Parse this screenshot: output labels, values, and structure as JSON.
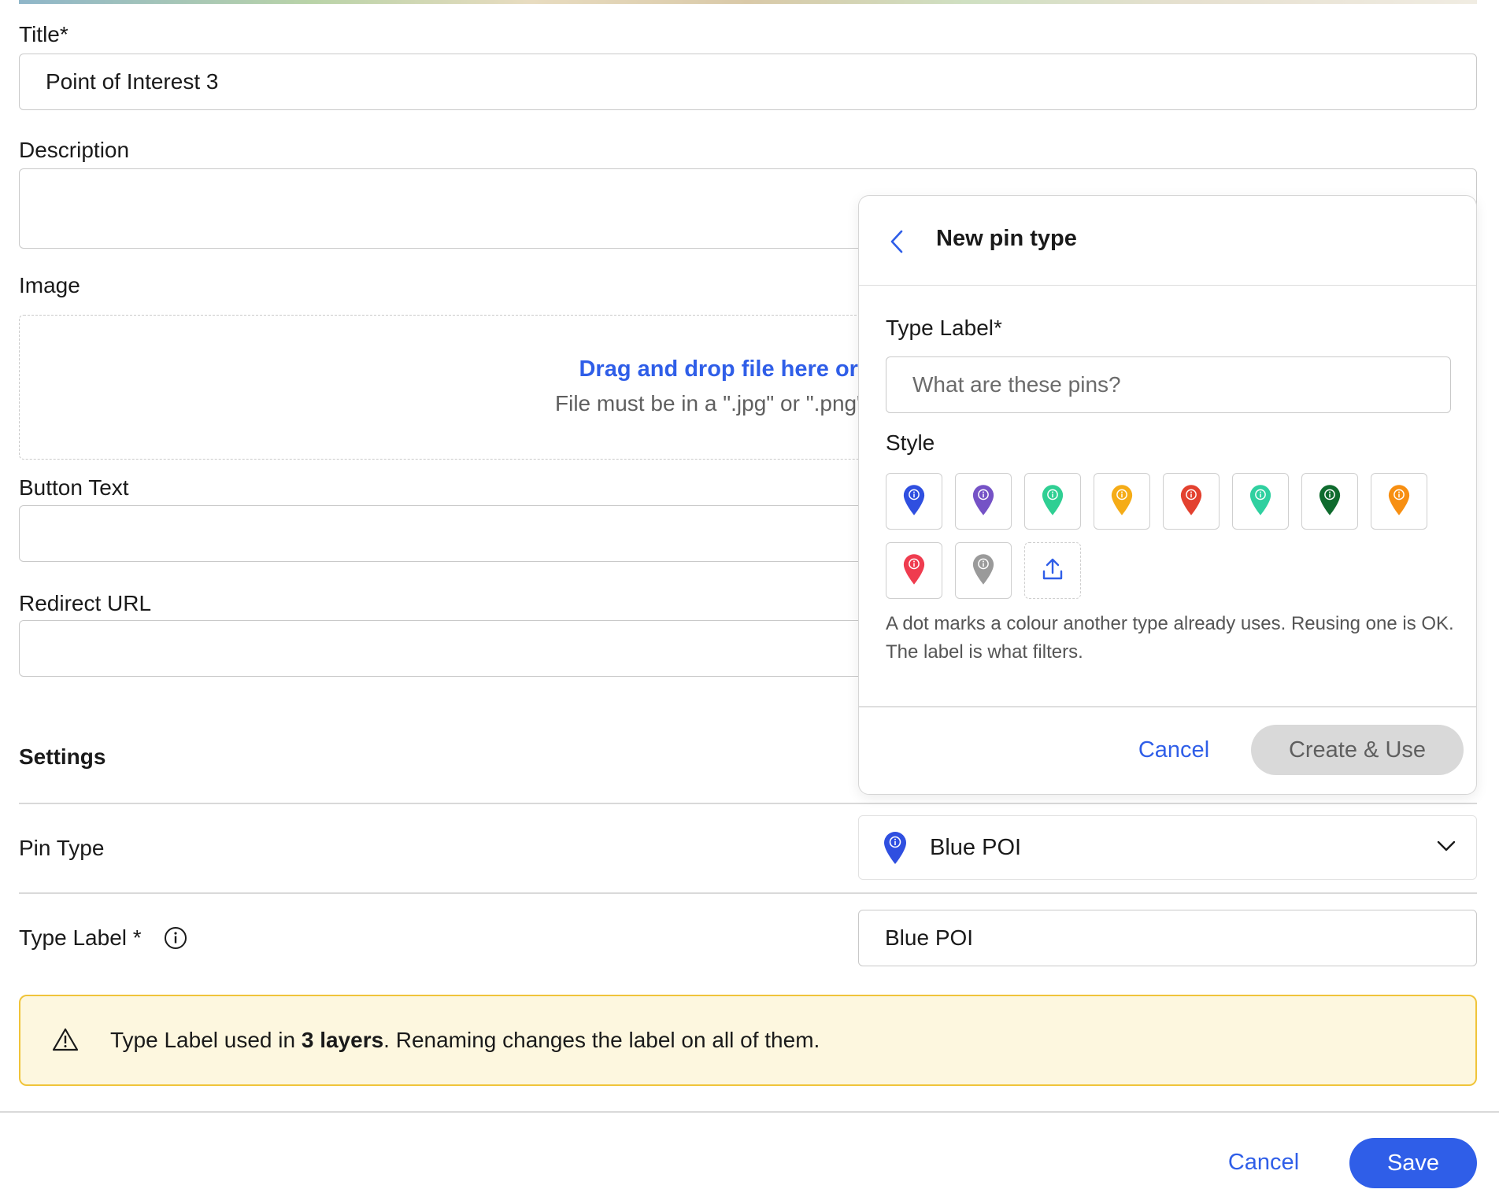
{
  "form": {
    "title_label": "Title*",
    "title_value": "Point of Interest 3",
    "description_label": "Description",
    "image_label": "Image",
    "dropzone_link": "Drag and drop file here or click",
    "dropzone_hint": "File must be in a \".jpg\" or \".png\" format.",
    "button_text_label": "Button Text",
    "redirect_url_label": "Redirect URL"
  },
  "settings": {
    "heading": "Settings",
    "pin_type_label": "Pin Type",
    "pin_type_value": "Blue POI",
    "type_label_label": "Type Label *",
    "type_label_value": "Blue POI"
  },
  "warning": {
    "prefix": "Type Label used in ",
    "bold": "3 layers",
    "suffix": ". Renaming changes the label on all of them."
  },
  "footer": {
    "cancel_label": "Cancel",
    "save_label": "Save"
  },
  "popover": {
    "title": "New pin type",
    "type_label_label": "Type Label*",
    "type_label_placeholder": "What are these pins?",
    "style_label": "Style",
    "note": "A dot marks a colour another type already uses. Reusing one is OK. The label is what filters.",
    "cancel_label": "Cancel",
    "create_label": "Create & Use",
    "swatches": [
      {
        "name": "blue",
        "color": "#2f4fe0"
      },
      {
        "name": "purple",
        "color": "#7552c6"
      },
      {
        "name": "teal",
        "color": "#2fcf93"
      },
      {
        "name": "amber",
        "color": "#f5ac17"
      },
      {
        "name": "red",
        "color": "#e3412f"
      },
      {
        "name": "mint",
        "color": "#2fd0a0"
      },
      {
        "name": "dark-green",
        "color": "#0f6b2e"
      },
      {
        "name": "orange",
        "color": "#f78f12"
      },
      {
        "name": "rose",
        "color": "#ef3c4f"
      },
      {
        "name": "gray",
        "color": "#9a9a9a"
      }
    ]
  },
  "colors": {
    "accent": "#2f5ee8",
    "warning_bg": "#fdf7df",
    "warning_border": "#f0c43a"
  }
}
